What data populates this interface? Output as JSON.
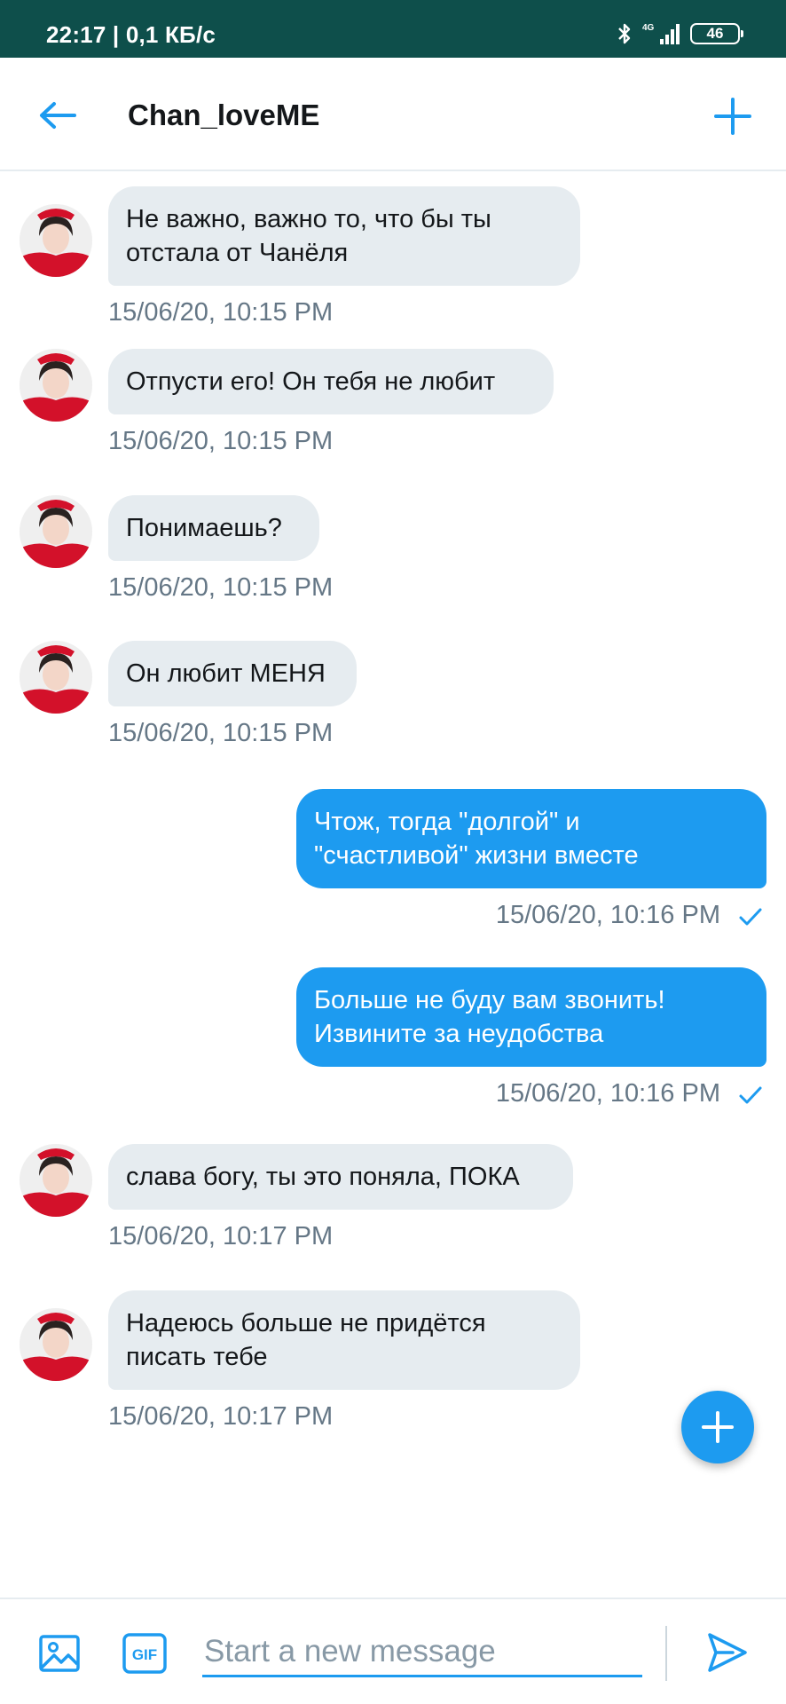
{
  "status_bar": {
    "time_speed": "22:17 | 0,1 КБ/с",
    "network": "4G",
    "battery": "46"
  },
  "header": {
    "title": "Chan_loveME",
    "back_icon": "arrow-left-icon",
    "add_icon": "plus-icon"
  },
  "messages": [
    {
      "direction": "in",
      "text": "Не важно, важно то, что бы ты\nотстала от Чанёля",
      "timestamp": "15/06/20, 10:15 PM"
    },
    {
      "direction": "in",
      "text": "Отпусти его! Он тебя не любит",
      "timestamp": "15/06/20, 10:15 PM"
    },
    {
      "direction": "in",
      "text": "Понимаешь?",
      "timestamp": "15/06/20, 10:15 PM"
    },
    {
      "direction": "in",
      "text": "Он любит МЕНЯ",
      "timestamp": "15/06/20, 10:15 PM"
    },
    {
      "direction": "out",
      "text": "Чтож, тогда \"долгой\" и\n\"счастливой\" жизни вместе",
      "timestamp": "15/06/20, 10:16 PM",
      "read": true
    },
    {
      "direction": "out",
      "text": "Больше не буду вам звонить!\nИзвините за неудобства",
      "timestamp": "15/06/20, 10:16 PM",
      "read": true
    },
    {
      "direction": "in",
      "text": "слава богу, ты это поняла, ПОКА",
      "timestamp": "15/06/20, 10:17 PM"
    },
    {
      "direction": "in",
      "text": "Надеюсь больше не придётся\nписать тебе",
      "timestamp": "15/06/20, 10:17 PM"
    }
  ],
  "composer": {
    "placeholder": "Start a new message",
    "value": "",
    "image_icon": "image-icon",
    "gif_label": "GIF",
    "send_icon": "send-icon"
  },
  "fab_icon": "plus-icon",
  "colors": {
    "accent": "#1d9bf0",
    "status_bar": "#0e4f4b",
    "incoming_bubble": "#e6ecf0",
    "timestamp": "#657786"
  }
}
